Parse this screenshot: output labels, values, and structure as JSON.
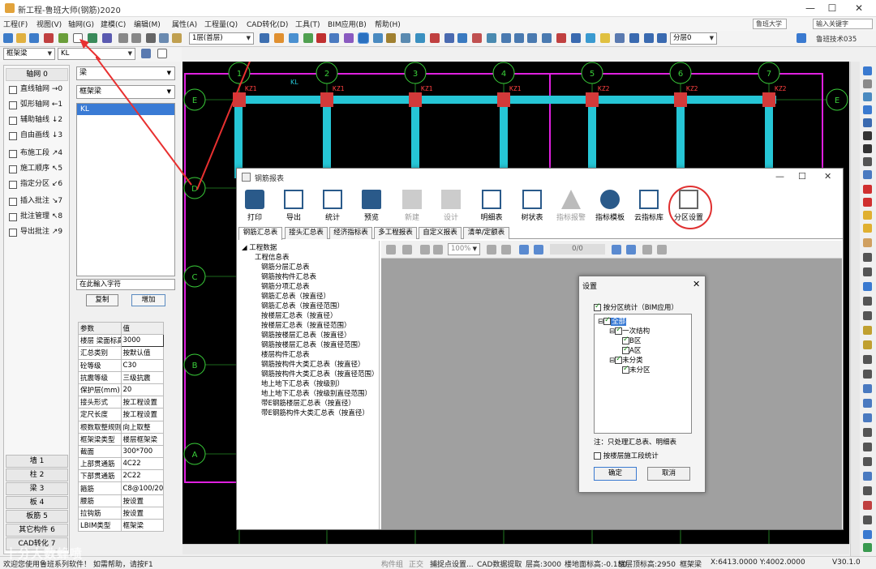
{
  "window": {
    "title": "新工程-鲁班大师(钢筋)2020"
  },
  "menu": [
    "工程(F)",
    "视图(V)",
    "轴网(G)",
    "建模(C)",
    "编辑(M)",
    "属性(A)",
    "工程量(Q)",
    "CAD转化(D)",
    "工具(T)",
    "BIM应用(B)",
    "帮助(H)"
  ],
  "top_right": {
    "user": "鲁班大学",
    "search_placeholder": "输入关键字",
    "brand": "鲁班技术035"
  },
  "toolbar": {
    "floor": "1层(首层)",
    "layer": "分层0"
  },
  "toolbar2": {
    "component_type": "框架梁",
    "component_name": "KL"
  },
  "leftnav": {
    "header": "轴网 0",
    "items": [
      {
        "label": "直线轴网",
        "shortcut": "→0"
      },
      {
        "label": "弧形轴网",
        "shortcut": "←1"
      },
      {
        "label": "辅助轴线",
        "shortcut": "↓2"
      },
      {
        "label": "自由画线",
        "shortcut": "↓3"
      },
      {
        "label": "布施工段",
        "shortcut": "↗4"
      },
      {
        "label": "施工顺序",
        "shortcut": "↖5"
      },
      {
        "label": "指定分区",
        "shortcut": "↙6"
      },
      {
        "label": "插入批注",
        "shortcut": "↘7"
      },
      {
        "label": "批注管理",
        "shortcut": "↖8"
      },
      {
        "label": "导出批注",
        "shortcut": "↗9"
      }
    ],
    "categories": [
      "墙 1",
      "柱 2",
      "梁 3",
      "板 4",
      "板筋 5",
      "其它构件 6",
      "CAD转化 7"
    ]
  },
  "prop": {
    "type": "梁",
    "subtype": "框架梁",
    "selected": "KL",
    "input_hint": "在此輸入字符",
    "copy": "复制",
    "add": "增加",
    "header": [
      "参数",
      "值"
    ],
    "rows": [
      [
        "楼层 梁面标高",
        "3000"
      ],
      [
        "汇总类别",
        "按默认值"
      ],
      [
        "砼等级",
        "C30"
      ],
      [
        "抗震等级",
        "三级抗震"
      ],
      [
        "保护层(mm)",
        "20"
      ],
      [
        "接头形式",
        "按工程设置"
      ],
      [
        "定尺长度",
        "按工程设置"
      ],
      [
        "根数取整规则",
        "向上取整"
      ],
      [
        "框架梁类型",
        "楼层框架梁"
      ],
      [
        "截面",
        "300*700"
      ],
      [
        "上部贯通筋",
        "4C22"
      ],
      [
        "下部贯通筋",
        "2C22"
      ],
      [
        "箍筋",
        "C8@100/200"
      ],
      [
        "腰筋",
        "按设置"
      ],
      [
        "拉钩筋",
        "按设置"
      ],
      [
        "LBIM类型",
        "框架梁"
      ]
    ]
  },
  "canvas": {
    "axis_numbers": [
      "1",
      "2",
      "3",
      "4",
      "5",
      "6",
      "7"
    ],
    "axis_letters": [
      "E",
      "D",
      "C",
      "B",
      "A"
    ],
    "column_label": "KZ1",
    "column_label2": "KZ2",
    "beam_label": "KL"
  },
  "report": {
    "title": "钢筋报表",
    "tools": [
      {
        "label": "打印",
        "disabled": false
      },
      {
        "label": "导出",
        "disabled": false
      },
      {
        "label": "统计",
        "disabled": false
      },
      {
        "label": "预览",
        "disabled": false
      },
      {
        "label": "新建",
        "disabled": true
      },
      {
        "label": "设计",
        "disabled": true
      },
      {
        "label": "明细表",
        "disabled": false
      },
      {
        "label": "树状表",
        "disabled": false
      },
      {
        "label": "指标报警",
        "disabled": true
      },
      {
        "label": "指标模板",
        "disabled": false
      },
      {
        "label": "云指标库",
        "disabled": false
      },
      {
        "label": "分区设置",
        "disabled": false
      }
    ],
    "tabs": [
      "钢筋汇总表",
      "接头汇总表",
      "经济指标表",
      "多工程报表",
      "自定义报表",
      "清单/定额表"
    ],
    "tree_root": "工程数据",
    "tree": [
      "工程信息表",
      "钢筋分层汇总表",
      "钢筋按构件汇总表",
      "钢筋分项汇总表",
      "钢筋汇总表（按直径）",
      "钢筋汇总表（按直径范围）",
      "按楼层汇总表（按直径）",
      "按楼层汇总表（按直径范围）",
      "钢筋按楼层汇总表（按直径）",
      "钢筋按楼层汇总表（按直径范围）",
      "楼层构件汇总表",
      "钢筋按构件大类汇总表（按直径）",
      "钢筋按构件大类汇总表（按直径范围）",
      "地上地下汇总表（按级别）",
      "地上地下汇总表（按级别直径范围）",
      "带E钢筋楼层汇总表（按直径）",
      "带E钢筋构件大类汇总表（按直径）"
    ],
    "zoom": "100%",
    "page": "0/0"
  },
  "settings": {
    "title": "设置",
    "by_zone": "按分区统计（BIM应用）",
    "nodes": [
      "全部",
      "一次结构",
      "B区",
      "A区",
      "未分类",
      "未分区"
    ],
    "note": "注：只处理汇总表、明细表",
    "by_floor": "按楼层施工段统计",
    "ok": "确定",
    "cancel": "取消"
  },
  "status": {
    "message": "欢迎您使用鲁班系列软件！ 如需帮助，请按F1",
    "mode1": "构件组",
    "mode2": "正交",
    "mode3": "捕捉点设置...",
    "mode4": "CAD数据提取",
    "floor_height": "层高:3000",
    "floor_bottom": "楼地面标高:-0.150",
    "floor_top": "楼层顶标高:2950",
    "component": "框架梁",
    "coords": "X:6413.0000 Y:4002.0000",
    "version": "V30.1.0"
  },
  "watermark": "十分大数蜂喷"
}
